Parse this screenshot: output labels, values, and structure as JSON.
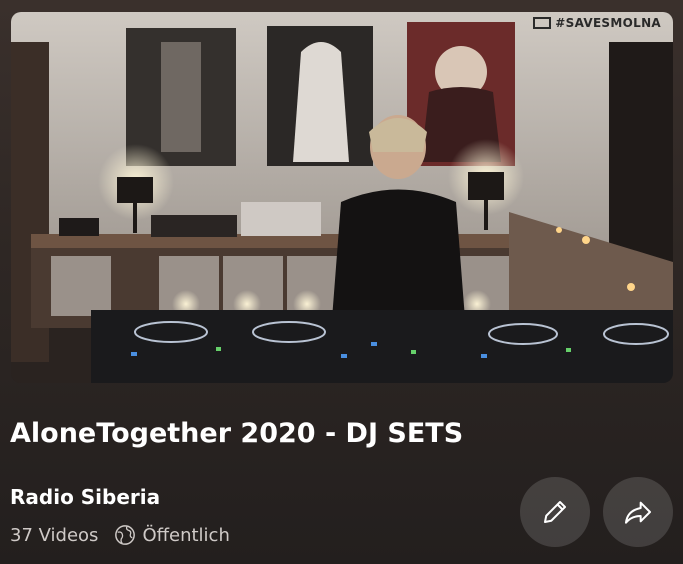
{
  "thumbnail": {
    "watermark": "#SAVESMOLNA"
  },
  "playlist": {
    "title": "AloneTogether 2020 - DJ SETS",
    "channel": "Radio Siberia",
    "video_count": "37 Videos",
    "visibility": "Öffentlich"
  },
  "actions": {
    "edit_icon": "pencil-icon",
    "share_icon": "share-arrow-icon"
  },
  "colors": {
    "background_top": "#3a302c",
    "background_bottom": "#231f1e",
    "text_secondary": "#cfcac7"
  }
}
